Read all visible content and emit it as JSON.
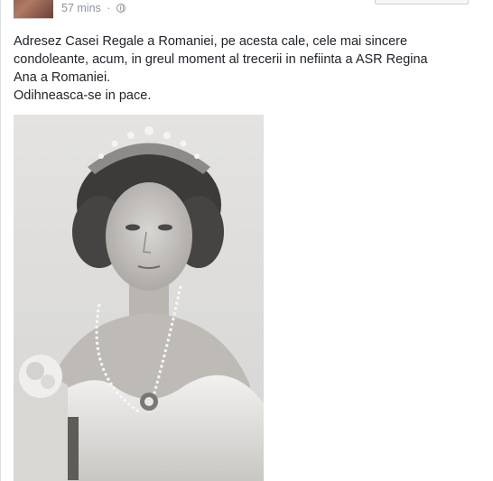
{
  "post": {
    "time": "57 mins",
    "separator": "·",
    "privacy_icon": "globe-icon",
    "message_lines": [
      "Adresez Casei Regale a Romaniei, pe acesta cale, cele mai sincere",
      "condoleante, acum, in greul moment al trecerii in nefiinta a ASR Regina",
      "Ana a Romaniei.",
      "Odihneasca-se in pace."
    ]
  },
  "colors": {
    "text": "#1d2129",
    "meta": "#8d949e",
    "photo_background": "#e7e6e4"
  }
}
